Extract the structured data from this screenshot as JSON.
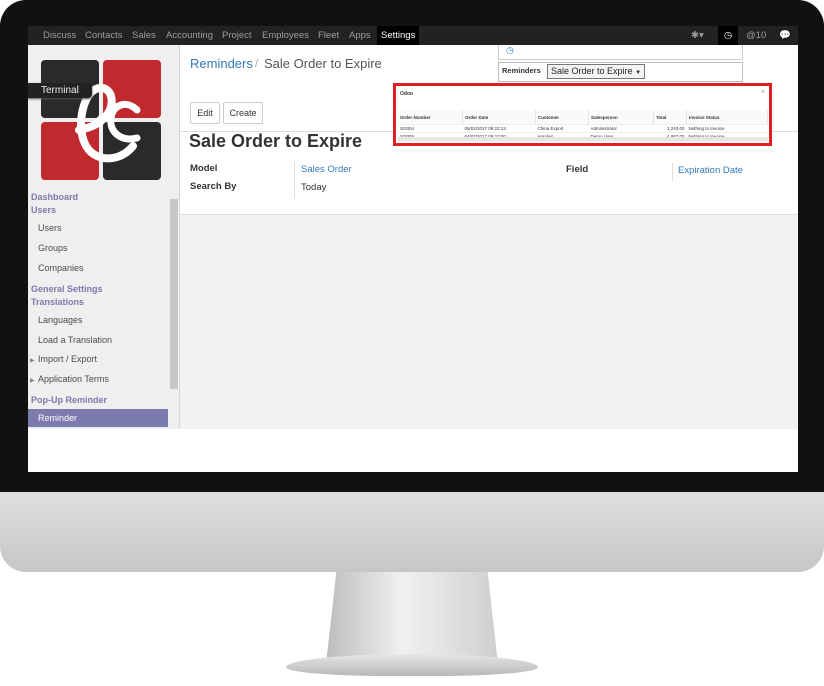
{
  "nav": {
    "items": [
      "Discuss",
      "Contacts",
      "Sales",
      "Accounting",
      "Project",
      "Employees",
      "Fleet",
      "Apps",
      "Settings"
    ],
    "active": "Settings",
    "message_count": "10"
  },
  "sidebar": {
    "terminal_label": "Terminal",
    "dashboard": "Dashboard",
    "users_section": "Users",
    "users_items": [
      "Users",
      "Groups",
      "Companies"
    ],
    "general_settings": "General Settings",
    "translations_section": "Translations",
    "translations_items": [
      "Languages",
      "Load a Translation"
    ],
    "import_export": "Import / Export",
    "application_terms": "Application Terms",
    "popup_reminder_section": "Pop-Up Reminder",
    "reminder_item": "Reminder"
  },
  "breadcrumb": {
    "parent": "Reminders",
    "separator": "/",
    "current": "Sale Order to Expire"
  },
  "buttons": {
    "edit": "Edit",
    "create": "Create"
  },
  "form": {
    "title": "Sale Order to Expire",
    "model_label": "Model",
    "model_value": "Sales Order",
    "search_by_label": "Search By",
    "search_by_value": "Today",
    "field_label": "Field",
    "field_value": "Expiration Date"
  },
  "reminders_dropdown": {
    "label": "Reminders",
    "selected": "Sale Order to Expire"
  },
  "popup": {
    "title": "Odoo",
    "close": "×",
    "columns": [
      "Order Number",
      "Order Date",
      "Customer",
      "Salesperson",
      "Total",
      "Invoice Status"
    ],
    "rows": [
      [
        "SO004",
        "05/02/2017 09:22:13",
        "China Export",
        "Administrator",
        "2,240.00",
        "Nothing to Invoice"
      ],
      [
        "SO005",
        "04/02/2017 09:22:00",
        "Agrolait",
        "Demo User",
        "4,887.00",
        "Nothing to Invoice"
      ]
    ]
  },
  "colors": {
    "accent": "#7c7bad",
    "link": "#337ab7",
    "popup_border": "#e02020",
    "logo_red": "#c02a2e",
    "logo_dark": "#2a2a2a"
  }
}
